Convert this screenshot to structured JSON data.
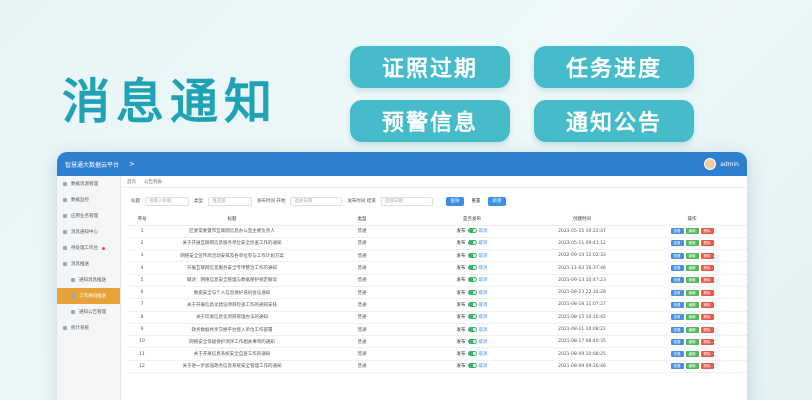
{
  "hero": {
    "title": "消息通知",
    "pills": [
      "证照过期",
      "任务进度",
      "预警信息",
      "通知公告"
    ]
  },
  "app": {
    "title": "智慧通大数据云平台",
    "collapse_icon": ">",
    "user_name": "admin"
  },
  "sidebar": {
    "items": [
      {
        "label": "数据资源管理"
      },
      {
        "label": "数据监控"
      },
      {
        "label": "应用业务管理"
      },
      {
        "label": "消息通知中心"
      },
      {
        "label": "待处理工作台"
      },
      {
        "label": "消息推送"
      }
    ],
    "subitems": [
      {
        "label": "通知消息推送"
      },
      {
        "label": "工作通知推送"
      },
      {
        "label": "通知公告管理"
      }
    ],
    "last": {
      "label": "统计系统"
    }
  },
  "breadcrumb": [
    "首页",
    "公告列表"
  ],
  "filters": {
    "title_label": "标题",
    "title_placeholder": "请输入标题",
    "type_label": "类型",
    "type_placeholder": "请选择",
    "start_label": "发布时间 开始",
    "start_placeholder": "选择日期",
    "end_label": "发布时间 结束",
    "end_placeholder": "选择日期",
    "search": "查询",
    "reset": "重置",
    "add": "新增"
  },
  "table": {
    "headers": [
      "序号",
      "标题",
      "类型",
      "是否发布",
      "创建时间",
      "操作"
    ],
    "switch_on": "发布",
    "switch_off": "取消",
    "ops": [
      "查看",
      "编辑",
      "删除"
    ],
    "rows": [
      {
        "no": "1",
        "title": "区委常委暨市互联网信息办公室主要负责人",
        "type": "普通",
        "time": "2023-05-15 10:22:47"
      },
      {
        "no": "2",
        "title": "关于开展互联网信息服务单位安全检查工作的通知",
        "type": "普通",
        "time": "2023-05-11 09:41:12"
      },
      {
        "no": "3",
        "title": "网络安全宣传周活动安排及各单位参与工作计划方案",
        "type": "普通",
        "time": "2022-09-14 12:02:33"
      },
      {
        "no": "4",
        "title": "开展互联网信息服务安全专项整治工作的通知",
        "type": "普通",
        "time": "2021-11-03 16:37:46"
      },
      {
        "no": "5",
        "title": "概述：网络信息安全管理与数据保护规定解读",
        "type": "普通",
        "time": "2021-09-13 10:47:23"
      },
      {
        "no": "6",
        "title": "数据安全与个人信息保护培训会议通知",
        "type": "普通",
        "time": "2021-08-23 22:34:28"
      },
      {
        "no": "7",
        "title": "关于开展信息化建设项目检查工作的通知安排",
        "type": "普通",
        "time": "2021-08-18 11:07:27"
      },
      {
        "no": "8",
        "title": "关于印发信息化项目管理办法的通知",
        "type": "普通",
        "time": "2021-08-15 10:26:42"
      },
      {
        "no": "9",
        "title": "政务数据共享交换平台接入单位工作部署",
        "type": "普通",
        "time": "2021-08-11 10:08:22"
      },
      {
        "no": "10",
        "title": "网络安全等级保护测评工作相关事项的通知",
        "type": "普通",
        "time": "2021-08-17 08:40:35"
      },
      {
        "no": "11",
        "title": "关于开展信息系统安全自查工作的通知",
        "type": "普通",
        "time": "2021-08-09 10:08:25"
      },
      {
        "no": "12",
        "title": "关于进一步加强政务信息系统安全管理工作的通知",
        "type": "普通",
        "time": "2021-08-09 09:26:46"
      }
    ]
  },
  "colors": {
    "accent": "#1fa3b4",
    "pill": "#46bccb",
    "topbar": "#2f7fd0",
    "active": "#e8a23a"
  }
}
